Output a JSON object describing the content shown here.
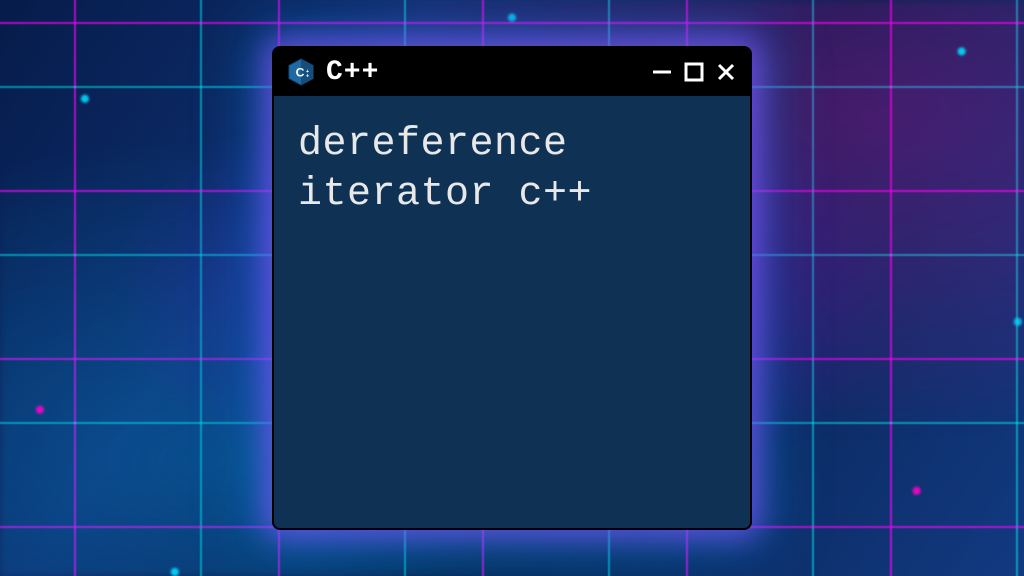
{
  "window": {
    "title": "C++",
    "icon": "cpp-hexagon-icon",
    "content_line1": "dereference",
    "content_line2": "iterator c++"
  },
  "controls": {
    "minimize": "−",
    "maximize": "□",
    "close": "✕"
  },
  "colors": {
    "window_bg": "#0f3254",
    "titlebar_bg": "#000000",
    "text": "#e8e8e8",
    "glow_magenta": "#ff00d4",
    "glow_cyan": "#00d4ff",
    "icon_blue": "#1f6aa5"
  }
}
